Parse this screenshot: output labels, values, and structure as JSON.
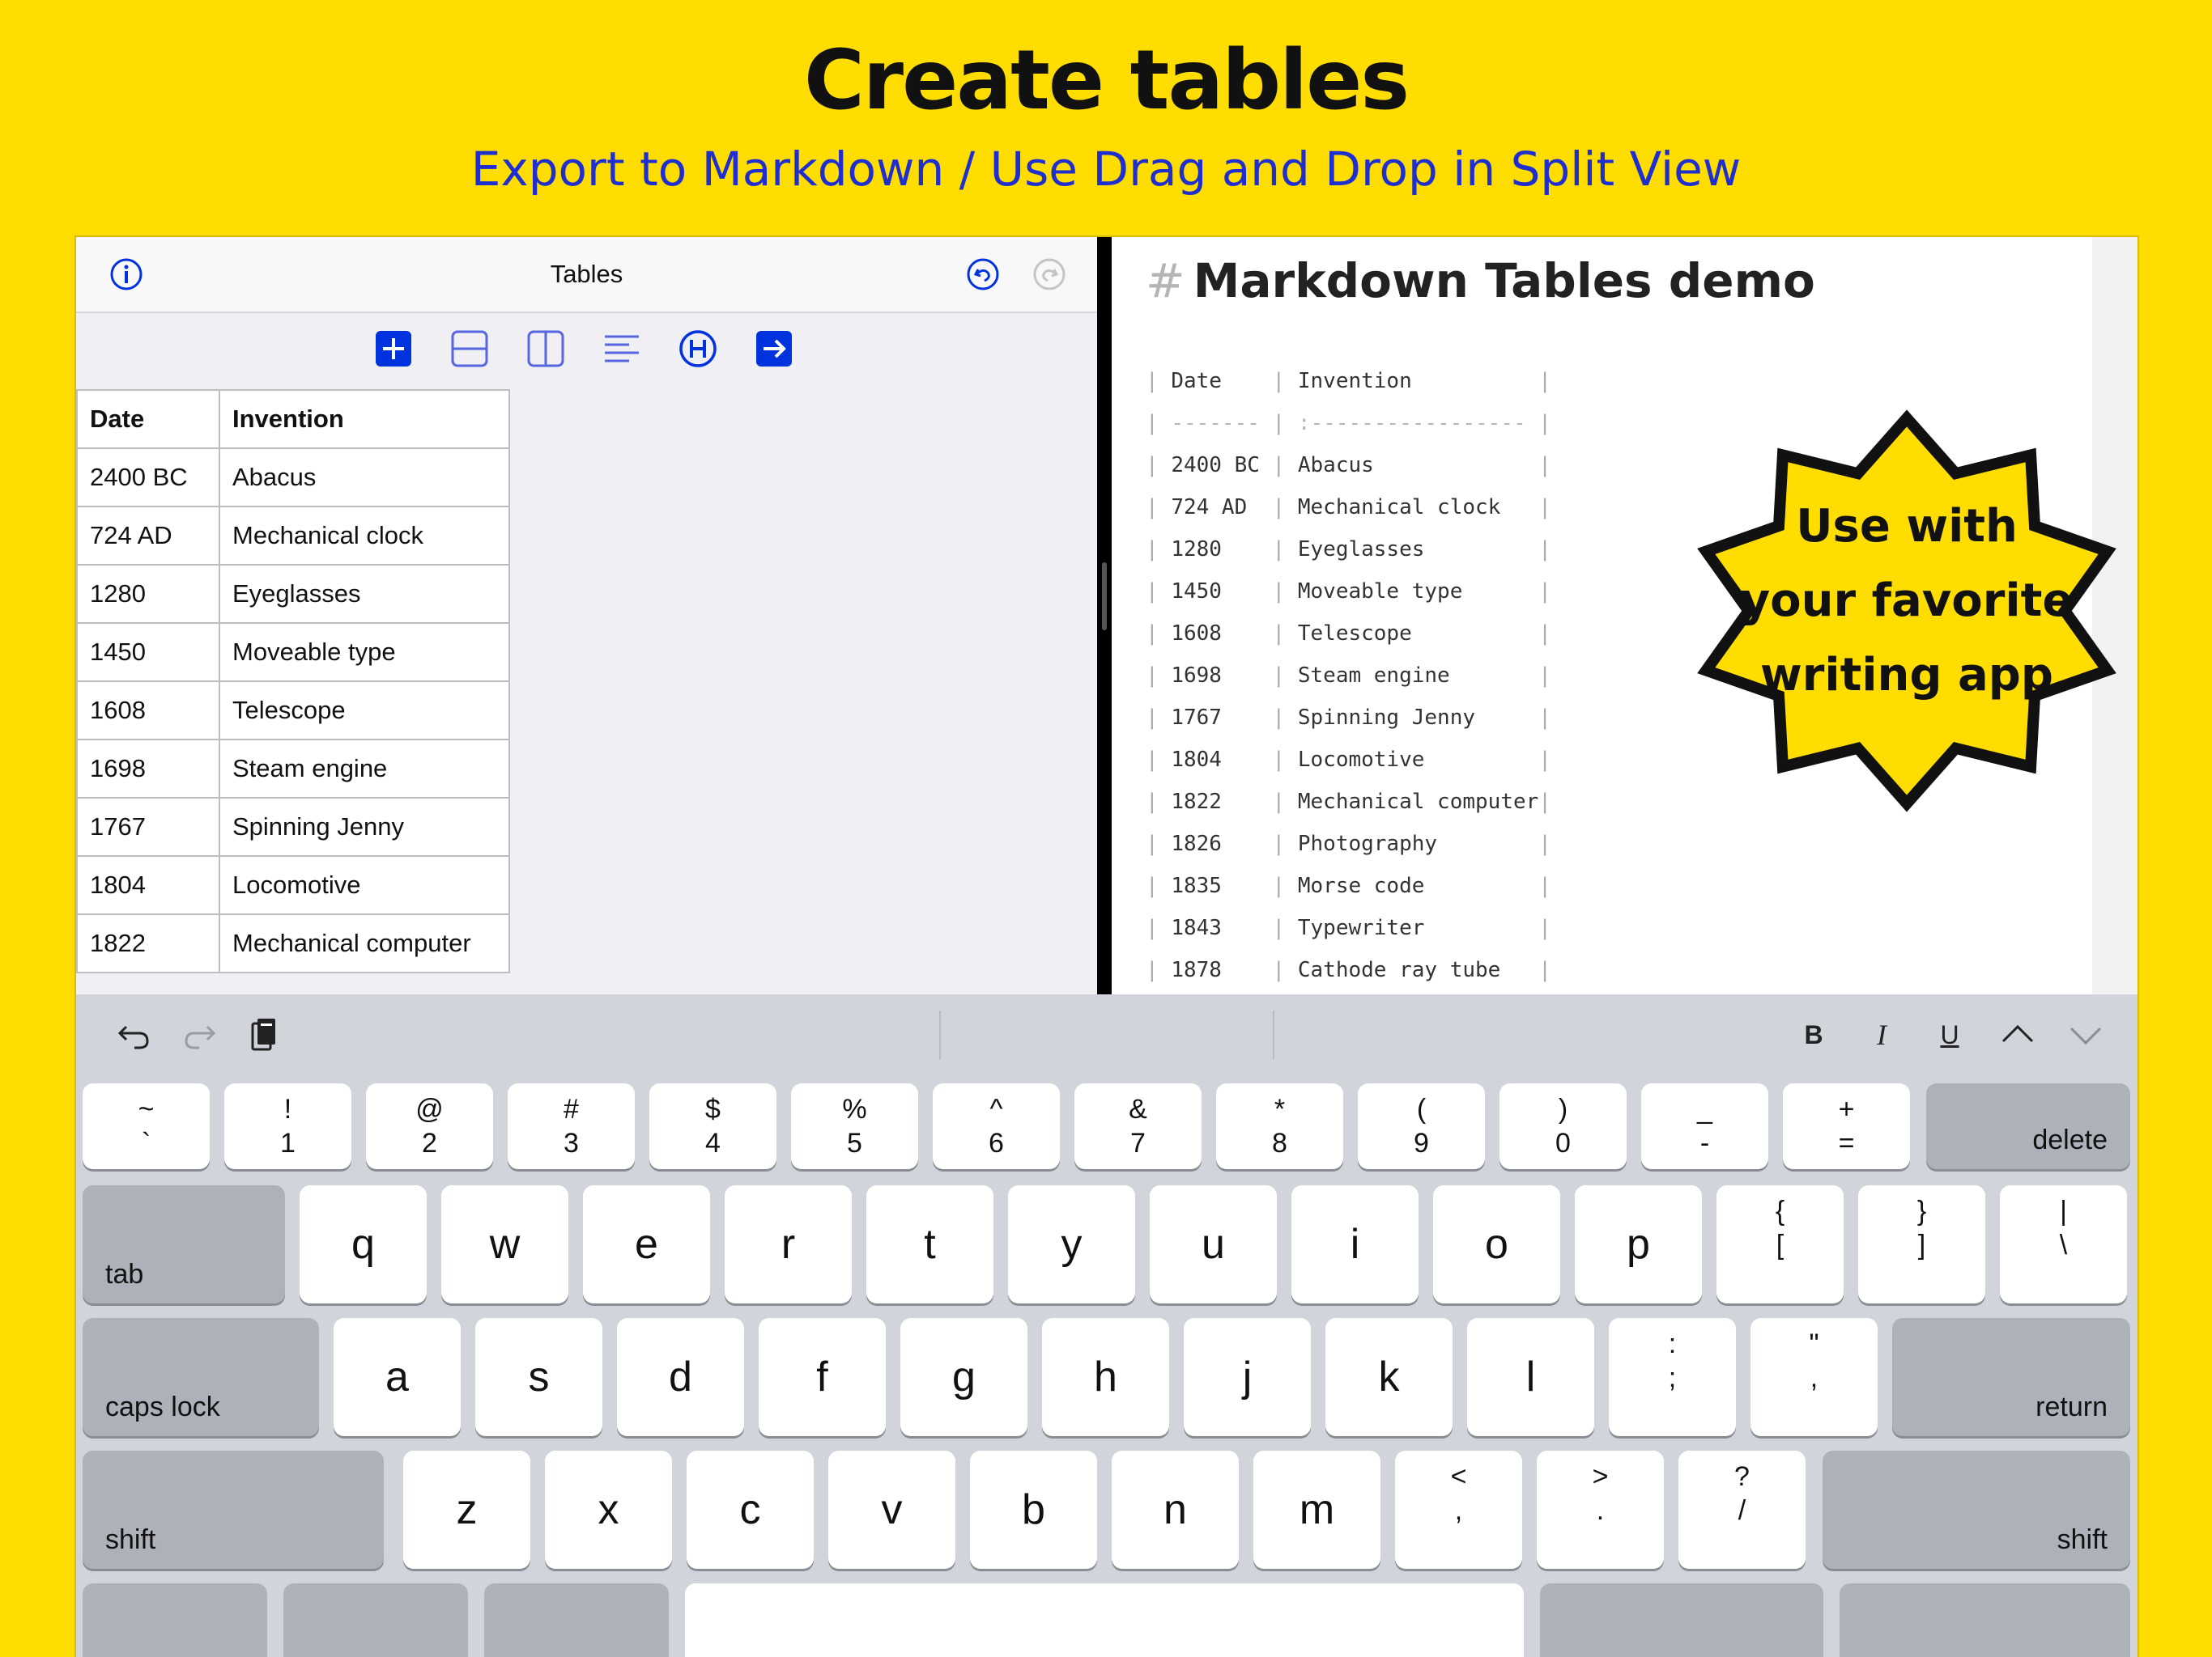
{
  "banner": {
    "title": "Create tables",
    "subtitle": "Export to Markdown / Use Drag and Drop in Split View"
  },
  "colors": {
    "background": "#FFDD00",
    "accent": "#1E2ECF",
    "icon_blue": "#0033DD"
  },
  "left_pane": {
    "nav_title": "Tables",
    "icons": [
      "info-icon",
      "undo-circle-icon",
      "redo-circle-icon"
    ],
    "toolbar_icons": [
      "add-icon",
      "insert-row-icon",
      "insert-column-icon",
      "align-left-icon",
      "header-icon",
      "export-icon"
    ],
    "table": {
      "headers": [
        "Date",
        "Invention"
      ],
      "rows": [
        [
          "2400 BC",
          "Abacus"
        ],
        [
          "724 AD",
          "Mechanical clock"
        ],
        [
          "1280",
          "Eyeglasses"
        ],
        [
          "1450",
          "Moveable type"
        ],
        [
          "1608",
          "Telescope"
        ],
        [
          "1698",
          "Steam engine"
        ],
        [
          "1767",
          "Spinning Jenny"
        ],
        [
          "1804",
          "Locomotive"
        ],
        [
          "1822",
          "Mechanical computer"
        ]
      ]
    }
  },
  "right_pane": {
    "hash": "#",
    "heading": "Markdown Tables demo",
    "header_row": [
      "Date",
      "Invention"
    ],
    "separator": [
      "-------",
      ":-----------------"
    ],
    "rows": [
      [
        "2400 BC",
        "Abacus"
      ],
      [
        "724 AD",
        "Mechanical clock"
      ],
      [
        "1280",
        "Eyeglasses"
      ],
      [
        "1450",
        "Moveable type"
      ],
      [
        "1608",
        "Telescope"
      ],
      [
        "1698",
        "Steam engine"
      ],
      [
        "1767",
        "Spinning Jenny"
      ],
      [
        "1804",
        "Locomotive"
      ],
      [
        "1822",
        "Mechanical computer"
      ],
      [
        "1826",
        "Photography"
      ],
      [
        "1835",
        "Morse code"
      ],
      [
        "1843",
        "Typewriter"
      ],
      [
        "1878",
        "Cathode ray tube"
      ]
    ],
    "badge": {
      "line1": "Use with",
      "line2": "your favorite",
      "line3": "writing app"
    }
  },
  "keyboard": {
    "shortcut_bar": {
      "left_icons": [
        "undo-arrow-icon",
        "redo-arrow-icon",
        "clipboard-icon"
      ],
      "right": [
        "B",
        "I",
        "U",
        "^",
        "v"
      ]
    },
    "number_row": [
      {
        "top": "~",
        "bottom": "`"
      },
      {
        "top": "!",
        "bottom": "1"
      },
      {
        "top": "@",
        "bottom": "2"
      },
      {
        "top": "#",
        "bottom": "3"
      },
      {
        "top": "$",
        "bottom": "4"
      },
      {
        "top": "%",
        "bottom": "5"
      },
      {
        "top": "^",
        "bottom": "6"
      },
      {
        "top": "&",
        "bottom": "7"
      },
      {
        "top": "*",
        "bottom": "8"
      },
      {
        "top": "(",
        "bottom": "9"
      },
      {
        "top": ")",
        "bottom": "0"
      },
      {
        "top": "_",
        "bottom": "-"
      },
      {
        "top": "+",
        "bottom": "="
      }
    ],
    "delete": "delete",
    "tab": "tab",
    "row_q": [
      "q",
      "w",
      "e",
      "r",
      "t",
      "y",
      "u",
      "i",
      "o",
      "p"
    ],
    "row_q_symbols": [
      {
        "top": "{",
        "bottom": "["
      },
      {
        "top": "}",
        "bottom": "]"
      },
      {
        "top": "|",
        "bottom": "\\"
      }
    ],
    "caps_lock": "caps lock",
    "row_a": [
      "a",
      "s",
      "d",
      "f",
      "g",
      "h",
      "j",
      "k",
      "l"
    ],
    "row_a_symbols": [
      {
        "top": ":",
        "bottom": ";"
      },
      {
        "top": "\"",
        "bottom": ","
      }
    ],
    "return": "return",
    "shift": "shift",
    "row_z": [
      "z",
      "x",
      "c",
      "v",
      "b",
      "n",
      "m"
    ],
    "row_z_symbols": [
      {
        "top": "<",
        "bottom": ","
      },
      {
        "top": ">",
        "bottom": "."
      },
      {
        "top": "?",
        "bottom": "/"
      }
    ]
  }
}
